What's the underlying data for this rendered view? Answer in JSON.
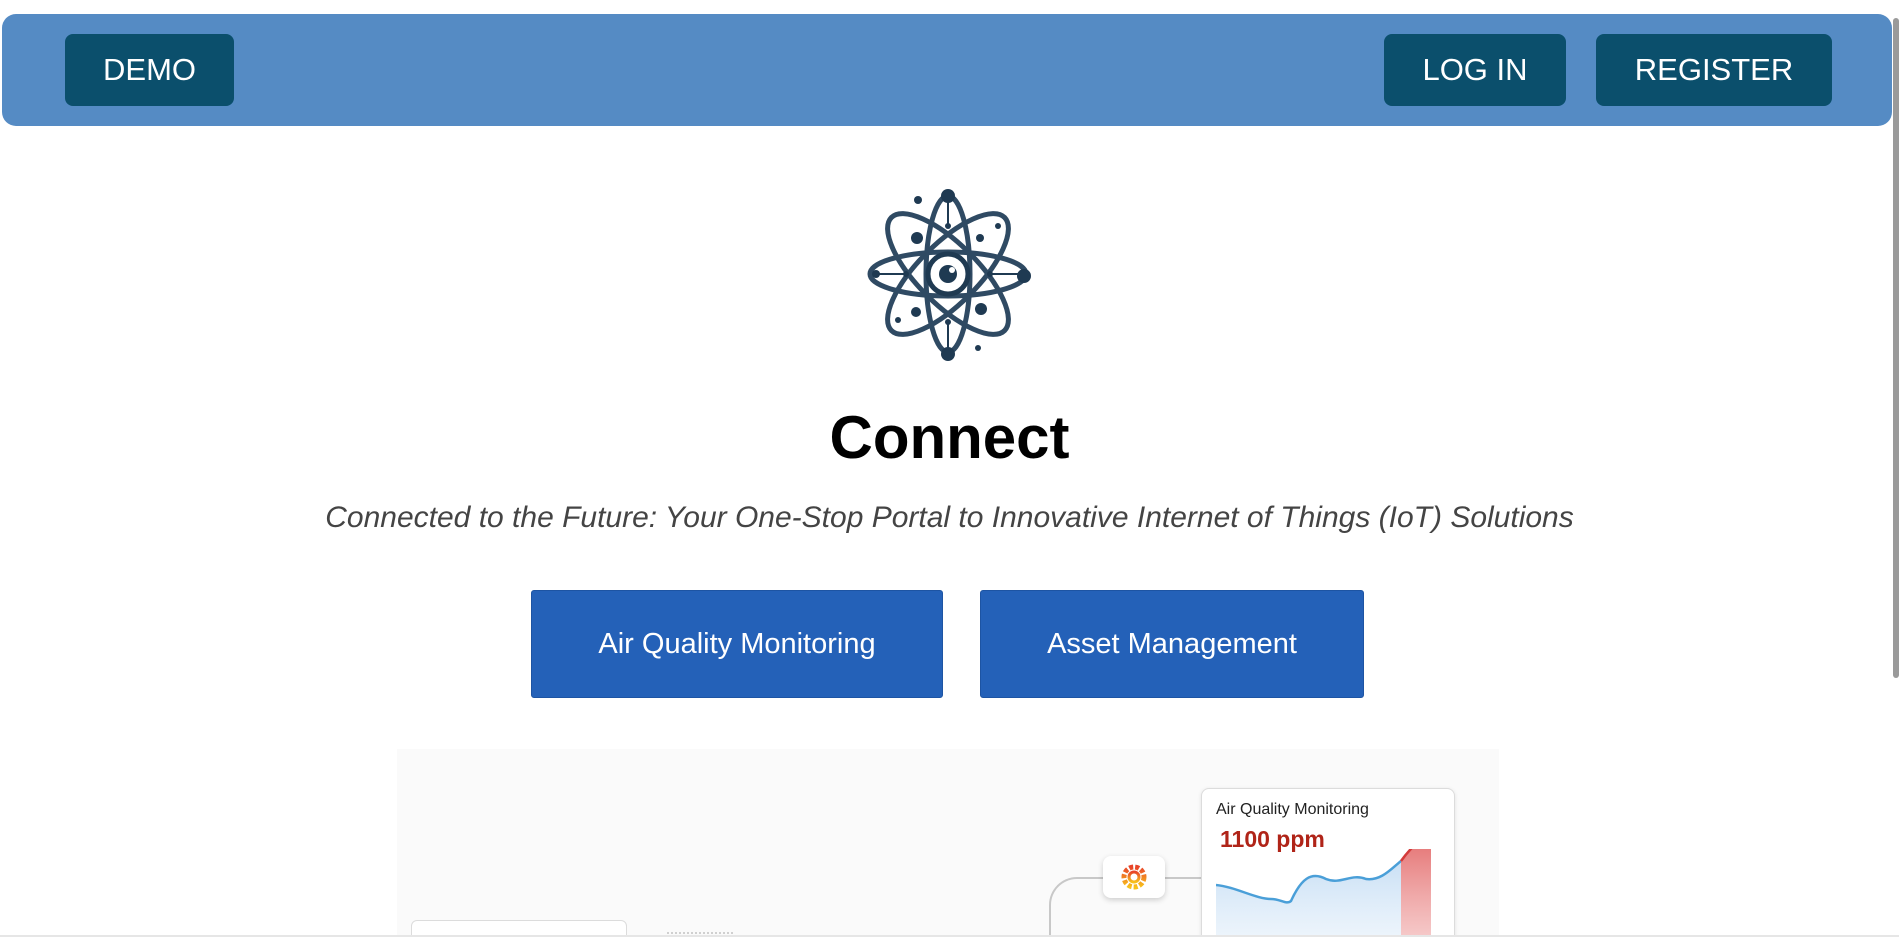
{
  "navbar": {
    "demo_label": "DEMO",
    "login_label": "LOG IN",
    "register_label": "REGISTER"
  },
  "hero": {
    "logo_icon": "atom-eye-icon",
    "title": "Connect",
    "subtitle": "Connected to the Future: Your One-Stop Portal to Innovative Internet of Things (IoT) Solutions"
  },
  "actions": {
    "air_quality_label": "Air Quality Monitoring",
    "asset_management_label": "Asset Management"
  },
  "preview": {
    "hub_icon": "grafana-icon",
    "card": {
      "title": "Air Quality Monitoring",
      "value": "1100 ppm"
    }
  },
  "colors": {
    "navbar": "#558bc4",
    "nav_button": "#0b4f6c",
    "cta_button": "#2461b8",
    "alert_value": "#b02418"
  }
}
